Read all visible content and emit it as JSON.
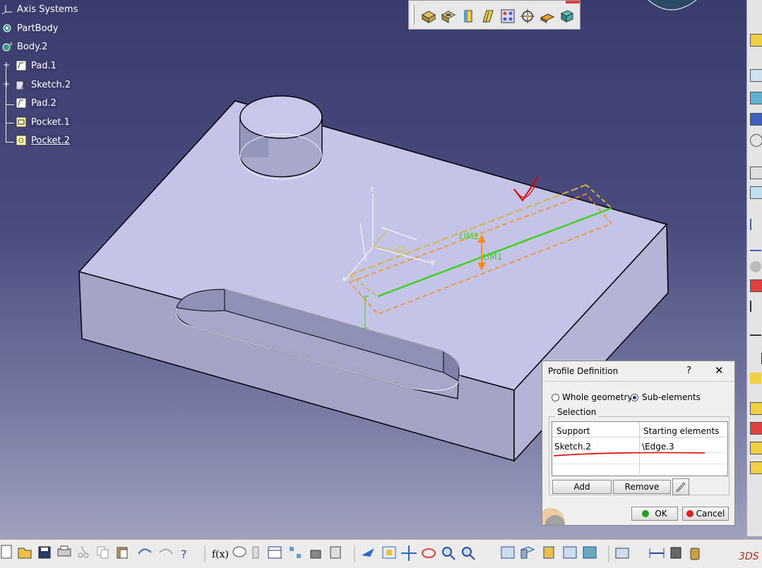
{
  "tree": {
    "items": [
      {
        "label": "Axis Systems",
        "icon": "axis-systems-icon"
      },
      {
        "label": "PartBody",
        "icon": "partbody-gear-icon"
      },
      {
        "label": "Body.2",
        "icon": "body-gear-icon"
      },
      {
        "label": "Pad.1",
        "icon": "pad-icon"
      },
      {
        "label": "Sketch.2",
        "icon": "sketch-icon"
      },
      {
        "label": "Pad.2",
        "icon": "pad-icon"
      },
      {
        "label": "Pocket.1",
        "icon": "pocket-icon"
      },
      {
        "label": "Pocket.2",
        "icon": "pocket-icon"
      }
    ]
  },
  "sketch_labels": {
    "lim2": "LIM2",
    "lim1": "LIM1",
    "z_axis": "z",
    "y_axis": "y",
    "x_axis": "x"
  },
  "dialog": {
    "title": "Profile Definition",
    "help": "?",
    "close": "✕",
    "radio_whole": "Whole geometry",
    "radio_sub": "Sub-elements",
    "selected_mode": "Sub-elements",
    "group_label": "Selection",
    "columns": [
      "Support",
      "Starting elements"
    ],
    "rows": [
      {
        "support": "Sketch.2",
        "starting": "\\Edge.3"
      }
    ],
    "add": "Add",
    "remove": "Remove",
    "ok": "OK",
    "cancel": "Cancel"
  },
  "colors": {
    "viewport": "#3a3c6e",
    "part_top": "#c6c6ea",
    "part_side": "#9a9ac0",
    "sketch_green": "#40d020",
    "sketch_orange": "#ff8c1a",
    "annotation_red": "#e00000"
  },
  "bottom_toolbar": {
    "icons": [
      "new-icon",
      "open-icon",
      "save-icon",
      "print-icon",
      "cut-icon",
      "copy-icon",
      "paste-icon",
      "undo-icon",
      "redo-icon",
      "whats-this-icon",
      "formula-icon",
      "comment-icon",
      "knowledge-icon",
      "table-icon",
      "tree-icon",
      "lock-icon",
      "tools-icon",
      "fly-icon",
      "fit-all-icon",
      "pan-icon",
      "rotate-icon",
      "zoom-in-icon",
      "zoom-out-icon",
      "normal-view-icon",
      "views-icon",
      "render-style-icon",
      "hide-show-icon",
      "swap-icon",
      "multi-view-icon",
      "measure-icon",
      "bottle-icon"
    ]
  },
  "top_toolbar": {
    "icons": [
      "pad-tool-icon",
      "pocket-tool-icon",
      "shaft-tool-icon",
      "rib-tool-icon",
      "hole-pattern-icon",
      "point-tool-icon",
      "plane-tool-icon",
      "solid-tool-icon"
    ]
  }
}
